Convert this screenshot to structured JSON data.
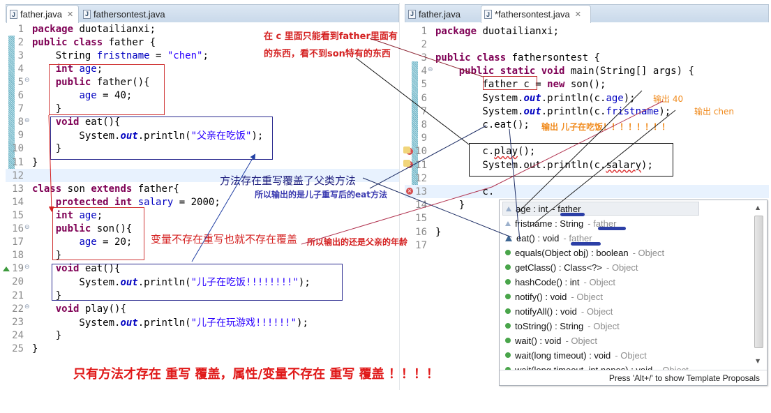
{
  "left_editor": {
    "tabs": [
      {
        "label": "father.java",
        "active": true,
        "closable": true
      },
      {
        "label": "fathersontest.java",
        "active": false
      }
    ],
    "lines": [
      {
        "n": "1",
        "html_key": "l1"
      },
      {
        "n": "2"
      },
      {
        "n": "3"
      },
      {
        "n": "4"
      },
      {
        "n": "5"
      },
      {
        "n": "6"
      },
      {
        "n": "7"
      },
      {
        "n": "8"
      },
      {
        "n": "9"
      },
      {
        "n": "10"
      },
      {
        "n": "11"
      },
      {
        "n": "12"
      },
      {
        "n": "13"
      },
      {
        "n": "14"
      },
      {
        "n": "15"
      },
      {
        "n": "16"
      },
      {
        "n": "17"
      },
      {
        "n": "18"
      },
      {
        "n": "19"
      },
      {
        "n": "20"
      },
      {
        "n": "21"
      },
      {
        "n": "22"
      },
      {
        "n": "23"
      },
      {
        "n": "24"
      },
      {
        "n": "25"
      }
    ],
    "code": [
      [
        {
          "t": "package",
          "c": "kw"
        },
        {
          "t": " duotailianxi;"
        }
      ],
      [
        {
          "t": "public",
          "c": "kw"
        },
        {
          "t": " "
        },
        {
          "t": "class",
          "c": "kw"
        },
        {
          "t": " father {"
        }
      ],
      [
        {
          "t": "    String "
        },
        {
          "t": "fristname",
          "c": "fld"
        },
        {
          "t": " = "
        },
        {
          "t": "\"chen\"",
          "c": "str"
        },
        {
          "t": ";"
        }
      ],
      [
        {
          "t": "    "
        },
        {
          "t": "int",
          "c": "kw"
        },
        {
          "t": " "
        },
        {
          "t": "age",
          "c": "fld"
        },
        {
          "t": ";"
        }
      ],
      [
        {
          "t": "    "
        },
        {
          "t": "public",
          "c": "kw"
        },
        {
          "t": " father(){"
        }
      ],
      [
        {
          "t": "        "
        },
        {
          "t": "age",
          "c": "fld"
        },
        {
          "t": " = 40;"
        }
      ],
      [
        {
          "t": "    }"
        }
      ],
      [
        {
          "t": "    "
        },
        {
          "t": "void",
          "c": "kw"
        },
        {
          "t": " eat(){"
        }
      ],
      [
        {
          "t": "        System."
        },
        {
          "t": "out",
          "c": "stat"
        },
        {
          "t": ".println("
        },
        {
          "t": "\"父亲在吃饭\"",
          "c": "str"
        },
        {
          "t": ");"
        }
      ],
      [
        {
          "t": "    }"
        }
      ],
      [
        {
          "t": "}"
        }
      ],
      [
        {
          "t": ""
        }
      ],
      [
        {
          "t": "class",
          "c": "kw"
        },
        {
          "t": " son "
        },
        {
          "t": "extends",
          "c": "kw"
        },
        {
          "t": " father{"
        }
      ],
      [
        {
          "t": "    "
        },
        {
          "t": "protected",
          "c": "kw"
        },
        {
          "t": " "
        },
        {
          "t": "int",
          "c": "kw"
        },
        {
          "t": " "
        },
        {
          "t": "salary",
          "c": "fld"
        },
        {
          "t": " = 2000;"
        }
      ],
      [
        {
          "t": "    "
        },
        {
          "t": "int",
          "c": "kw"
        },
        {
          "t": " "
        },
        {
          "t": "age",
          "c": "fld"
        },
        {
          "t": ";"
        }
      ],
      [
        {
          "t": "    "
        },
        {
          "t": "public",
          "c": "kw"
        },
        {
          "t": " son(){"
        }
      ],
      [
        {
          "t": "        "
        },
        {
          "t": "age",
          "c": "fld"
        },
        {
          "t": " = 20;"
        }
      ],
      [
        {
          "t": "    }"
        }
      ],
      [
        {
          "t": "    "
        },
        {
          "t": "void",
          "c": "kw"
        },
        {
          "t": " eat(){"
        }
      ],
      [
        {
          "t": "        System."
        },
        {
          "t": "out",
          "c": "stat"
        },
        {
          "t": ".println("
        },
        {
          "t": "\"儿子在吃饭!!!!!!!!\"",
          "c": "str"
        },
        {
          "t": ");"
        }
      ],
      [
        {
          "t": "    }"
        }
      ],
      [
        {
          "t": "    "
        },
        {
          "t": "void",
          "c": "kw"
        },
        {
          "t": " play(){"
        }
      ],
      [
        {
          "t": "        System."
        },
        {
          "t": "out",
          "c": "stat"
        },
        {
          "t": ".println("
        },
        {
          "t": "\"儿子在玩游戏!!!!!!\"",
          "c": "str"
        },
        {
          "t": ");"
        }
      ],
      [
        {
          "t": "    }"
        }
      ],
      [
        {
          "t": "}"
        }
      ]
    ]
  },
  "right_editor": {
    "tabs": [
      {
        "label": "father.java",
        "active": false
      },
      {
        "label": "*fathersontest.java",
        "active": true,
        "closable": true
      }
    ],
    "code": [
      [
        {
          "t": "package",
          "c": "kw"
        },
        {
          "t": " duotailianxi;"
        }
      ],
      [
        {
          "t": ""
        }
      ],
      [
        {
          "t": "public",
          "c": "kw"
        },
        {
          "t": " "
        },
        {
          "t": "class",
          "c": "kw"
        },
        {
          "t": " fathersontest {"
        }
      ],
      [
        {
          "t": "    "
        },
        {
          "t": "public",
          "c": "kw"
        },
        {
          "t": " "
        },
        {
          "t": "static",
          "c": "kw"
        },
        {
          "t": " "
        },
        {
          "t": "void",
          "c": "kw"
        },
        {
          "t": " main(String[] args) {"
        }
      ],
      [
        {
          "t": "        father c = "
        },
        {
          "t": "new",
          "c": "kw"
        },
        {
          "t": " son();"
        }
      ],
      [
        {
          "t": "        System."
        },
        {
          "t": "out",
          "c": "stat"
        },
        {
          "t": ".println(c."
        },
        {
          "t": "age",
          "c": "fld"
        },
        {
          "t": ");"
        }
      ],
      [
        {
          "t": "        System."
        },
        {
          "t": "out",
          "c": "stat"
        },
        {
          "t": ".println(c."
        },
        {
          "t": "fristname",
          "c": "fld"
        },
        {
          "t": ");"
        }
      ],
      [
        {
          "t": "        c.eat();"
        }
      ],
      [
        {
          "t": ""
        }
      ],
      [
        {
          "t": "        c."
        },
        {
          "t": "play",
          "c": "squiggle"
        },
        {
          "t": "();"
        }
      ],
      [
        {
          "t": "        System.out.println(c."
        },
        {
          "t": "salary",
          "c": "squiggle"
        },
        {
          "t": ");"
        }
      ],
      [
        {
          "t": ""
        }
      ],
      [
        {
          "t": "        c."
        }
      ],
      [
        {
          "t": "    }"
        }
      ],
      [
        {
          "t": ""
        }
      ],
      [
        {
          "t": "}"
        }
      ],
      [
        {
          "t": ""
        }
      ]
    ]
  },
  "proposals": {
    "items": [
      {
        "icon": "field-default-icon",
        "sig": "age : int",
        "sep": " - ",
        "owner": "father",
        "selected": true
      },
      {
        "icon": "field-default-icon",
        "sig": "fristname : String",
        "sep": " - ",
        "owner": "father"
      },
      {
        "icon": "method-default-icon",
        "sig": "eat() : void",
        "sep": " - ",
        "owner": "father"
      },
      {
        "icon": "public-method-icon",
        "sig": "equals(Object obj) : boolean",
        "sep": " - ",
        "owner": "Object"
      },
      {
        "icon": "public-method-icon",
        "sig": "getClass() : Class<?>",
        "sep": " - ",
        "owner": "Object"
      },
      {
        "icon": "public-method-icon",
        "sig": "hashCode() : int",
        "sep": " - ",
        "owner": "Object"
      },
      {
        "icon": "public-method-icon",
        "sig": "notify() : void",
        "sep": " - ",
        "owner": "Object"
      },
      {
        "icon": "public-method-icon",
        "sig": "notifyAll() : void",
        "sep": " - ",
        "owner": "Object"
      },
      {
        "icon": "public-method-icon",
        "sig": "toString() : String",
        "sep": " - ",
        "owner": "Object"
      },
      {
        "icon": "public-method-icon",
        "sig": "wait() : void",
        "sep": " - ",
        "owner": "Object"
      },
      {
        "icon": "public-method-icon",
        "sig": "wait(long timeout) : void",
        "sep": " - ",
        "owner": "Object"
      },
      {
        "icon": "public-method-icon",
        "sig": "wait(long timeout, int nanos) : void",
        "sep": " - ",
        "owner": "Object"
      }
    ],
    "footer": "Press 'Alt+/' to show Template Proposals"
  },
  "annotations": {
    "top_note_line1": "在 c 里面只能看到father里面有",
    "top_note_line2": "的东西，看不到son特有的东西",
    "method_override": "方法存在重写覆盖了父类方法",
    "method_output": "所以输出的是儿子重写后的eat方法",
    "var_no_override": "变量不存在重写也就不存在覆盖",
    "var_output": "所以输出的还是父亲的年龄",
    "output_40": "输出 40",
    "output_chen": "输出 chen",
    "output_eat": "输出  儿子在吃饭！！！！！！！！",
    "bottom_conclusion": "只有方法才存在 重写 覆盖，属性/变量不存在 重写 覆盖  ！！！！"
  },
  "colors": {
    "annotation_red": "#d42020",
    "annotation_blue": "#2b2ba0",
    "annotation_orange": "#f08a1c",
    "keyword": "#7f0055",
    "field": "#0000c0",
    "string": "#2a00ff"
  }
}
